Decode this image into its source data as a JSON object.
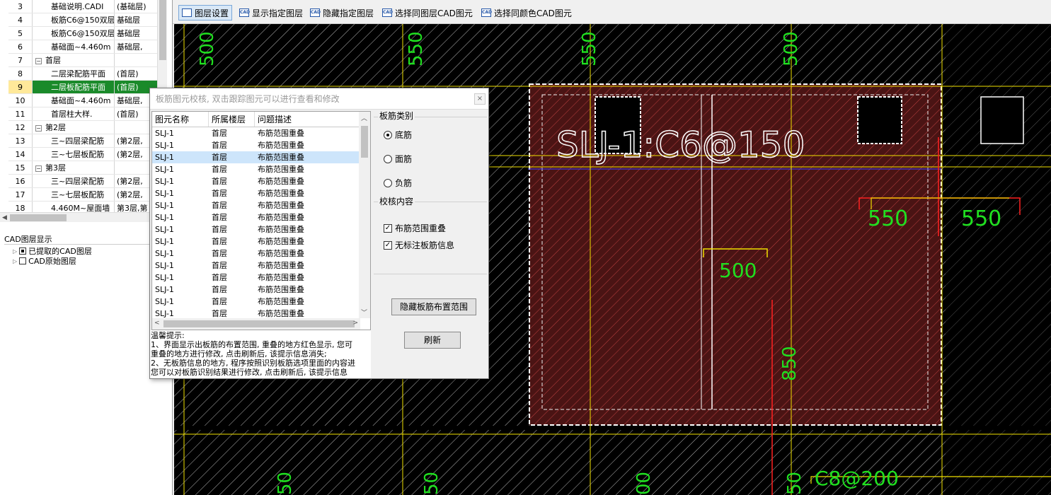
{
  "tree": {
    "rows": [
      {
        "num": "3",
        "name": "基础说明.CADI",
        "floor": "(基础层)",
        "kind": "child"
      },
      {
        "num": "4",
        "name": "板筋C6@150双层",
        "floor": "基础层",
        "kind": "child"
      },
      {
        "num": "5",
        "name": "板筋C6@150双层",
        "floor": "基础层",
        "kind": "child"
      },
      {
        "num": "6",
        "name": "基础面~4.460m",
        "floor": "基础层,",
        "kind": "child"
      },
      {
        "num": "7",
        "name": "首层",
        "floor": "",
        "kind": "group"
      },
      {
        "num": "8",
        "name": "二层梁配筋平面",
        "floor": "(首层)",
        "kind": "child"
      },
      {
        "num": "9",
        "name": "二层板配筋平面",
        "floor": "(首层)",
        "kind": "child",
        "selected": true
      },
      {
        "num": "10",
        "name": "基础面~4.460m",
        "floor": "基础层,",
        "kind": "child"
      },
      {
        "num": "11",
        "name": "首层柱大样.",
        "floor": "(首层)",
        "kind": "child"
      },
      {
        "num": "12",
        "name": "第2层",
        "floor": "",
        "kind": "group"
      },
      {
        "num": "13",
        "name": "三~四层梁配筋",
        "floor": "(第2层,",
        "kind": "child"
      },
      {
        "num": "14",
        "name": "三~七层板配筋",
        "floor": "(第2层,",
        "kind": "child"
      },
      {
        "num": "15",
        "name": "第3层",
        "floor": "",
        "kind": "group"
      },
      {
        "num": "16",
        "name": "三~四层梁配筋",
        "floor": "(第2层,",
        "kind": "child"
      },
      {
        "num": "17",
        "name": "三~七层板配筋",
        "floor": "(第2层,",
        "kind": "child"
      },
      {
        "num": "18",
        "name": "4.460M~屋面墙",
        "floor": "第3层,第",
        "kind": "child"
      }
    ],
    "group_expander": "−"
  },
  "cad_layers": {
    "title": "CAD图层显示",
    "items": [
      {
        "label": "已提取的CAD图层",
        "filled": true
      },
      {
        "label": "CAD原始图层",
        "filled": false
      }
    ]
  },
  "toolbar": {
    "buttons": [
      {
        "label": "图层设置",
        "icon": "layer-settings-icon",
        "active": true
      },
      {
        "label": "显示指定图层",
        "icon": "cad-show-layer-icon"
      },
      {
        "label": "隐藏指定图层",
        "icon": "cad-hide-layer-icon"
      },
      {
        "label": "选择同图层CAD图元",
        "icon": "cad-select-same-layer-icon"
      },
      {
        "label": "选择同颜色CAD图元",
        "icon": "cad-select-same-color-icon"
      }
    ],
    "cad_icon_text": "CAD"
  },
  "dialog": {
    "title": "板筋图元校核, 双击跟踪图元可以进行查看和修改",
    "close": "×",
    "columns": [
      "图元名称",
      "所属楼层",
      "问题描述"
    ],
    "rows": [
      [
        "SLJ-1",
        "首层",
        "布筋范围重叠"
      ],
      [
        "SLJ-1",
        "首层",
        "布筋范围重叠"
      ],
      [
        "SLJ-1",
        "首层",
        "布筋范围重叠"
      ],
      [
        "SLJ-1",
        "首层",
        "布筋范围重叠"
      ],
      [
        "SLJ-1",
        "首层",
        "布筋范围重叠"
      ],
      [
        "SLJ-1",
        "首层",
        "布筋范围重叠"
      ],
      [
        "SLJ-1",
        "首层",
        "布筋范围重叠"
      ],
      [
        "SLJ-1",
        "首层",
        "布筋范围重叠"
      ],
      [
        "SLJ-1",
        "首层",
        "布筋范围重叠"
      ],
      [
        "SLJ-1",
        "首层",
        "布筋范围重叠"
      ],
      [
        "SLJ-1",
        "首层",
        "布筋范围重叠"
      ],
      [
        "SLJ-1",
        "首层",
        "布筋范围重叠"
      ],
      [
        "SLJ-1",
        "首层",
        "布筋范围重叠"
      ],
      [
        "SLJ-1",
        "首层",
        "布筋范围重叠"
      ],
      [
        "SLJ-1",
        "首层",
        "布筋范围重叠"
      ],
      [
        "SLJ-1",
        "首层",
        "布筋范围重叠"
      ]
    ],
    "highlighted_row": 2,
    "rebar_type_label": "板筋类别",
    "rebar_types": [
      {
        "label": "底筋",
        "checked": true
      },
      {
        "label": "面筋",
        "checked": false
      },
      {
        "label": "负筋",
        "checked": false
      }
    ],
    "check_content_label": "校核内容",
    "checks": [
      {
        "label": "布筋范围重叠",
        "checked": true
      },
      {
        "label": "无标注板筋信息",
        "checked": true
      }
    ],
    "check_mark": "✓",
    "hide_range_button": "隐藏板筋布置范围",
    "refresh_button": "刷新",
    "tips": [
      "温馨提示:",
      "1、界面显示出板筋的布置范围, 重叠的地方红色显示, 您可",
      "重叠的地方进行修改, 点击刷新后, 该提示信息消失;",
      "2、无板筋信息的地方, 程序按照识别板筋选项里面的内容进",
      "您可以对板筋识别结果进行修改, 点击刷新后, 该提示信息"
    ]
  },
  "cad": {
    "slab_label": "SLJ-1:C6@150",
    "dims": [
      "500",
      "550",
      "550",
      "500",
      "550",
      "550",
      "500",
      "850",
      "C8@200",
      "50",
      "50",
      "00",
      "50"
    ],
    "colors": {
      "bg": "#000000",
      "yellow": "#f0e000",
      "red": "#ff2020",
      "green": "#20e020",
      "white": "#ffffff",
      "hatch": "#8a3030"
    }
  }
}
